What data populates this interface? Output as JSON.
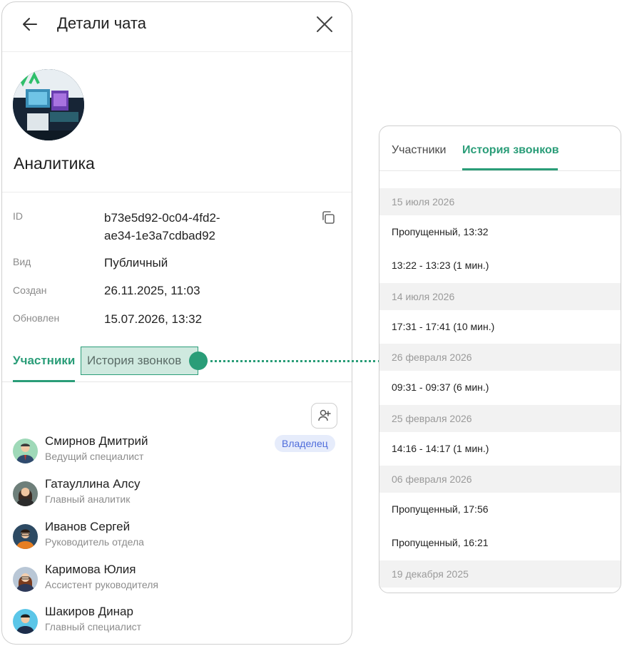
{
  "header": {
    "title": "Детали чата"
  },
  "chat": {
    "name": "Аналитика",
    "avatar_logo": "IVA",
    "info": [
      {
        "label": "ID",
        "value": "b73e5d92-0c04-4fd2-ae34-1e3a7cdbad92"
      },
      {
        "label": "Вид",
        "value": "Публичный"
      },
      {
        "label": "Создан",
        "value": "26.11.2025, 11:03"
      },
      {
        "label": "Обновлен",
        "value": "15.07.2026, 13:32"
      }
    ],
    "id_line1": "b73e5d92-0c04-4fd2-",
    "id_line2": "ae34-1e3a7cdbad92"
  },
  "tabs": {
    "participants": "Участники",
    "call_history": "История звонков"
  },
  "members": [
    {
      "name": "Смирнов Дмитрий",
      "role": "Ведущий специалист",
      "badge": "Владелец"
    },
    {
      "name": "Гатауллина Алсу",
      "role": "Главный аналитик"
    },
    {
      "name": "Иванов Сергей",
      "role": "Руководитель отдела"
    },
    {
      "name": "Каримова Юлия",
      "role": "Ассистент руководителя"
    },
    {
      "name": "Шакиров Динар",
      "role": "Главный специалист"
    }
  ],
  "call_history": [
    {
      "type": "date",
      "text": "15 июля 2026"
    },
    {
      "type": "call",
      "text": "Пропущенный, 13:32"
    },
    {
      "type": "call",
      "text": "13:22 - 13:23 (1 мин.)"
    },
    {
      "type": "date",
      "text": "14 июля 2026"
    },
    {
      "type": "call",
      "text": "17:31 - 17:41 (10 мин.)"
    },
    {
      "type": "date",
      "text": "26 февраля 2026"
    },
    {
      "type": "call",
      "text": "09:31 - 09:37 (6 мин.)"
    },
    {
      "type": "date",
      "text": "25 февраля 2026"
    },
    {
      "type": "call",
      "text": "14:16 - 14:17 (1 мин.)"
    },
    {
      "type": "date",
      "text": "06 февраля 2026"
    },
    {
      "type": "call",
      "text": "Пропущенный, 17:56"
    },
    {
      "type": "call",
      "text": "Пропущенный, 16:21"
    },
    {
      "type": "date",
      "text": "19 декабря 2025"
    }
  ],
  "colors": {
    "accent": "#2a9d78",
    "badge_bg": "#e6ecfb",
    "badge_text": "#4f6ddb",
    "highlight_bg": "#cfe9df"
  },
  "icons": {
    "back": "arrow-left-icon",
    "close": "close-icon",
    "copy": "copy-icon",
    "add_user": "add-user-icon"
  }
}
